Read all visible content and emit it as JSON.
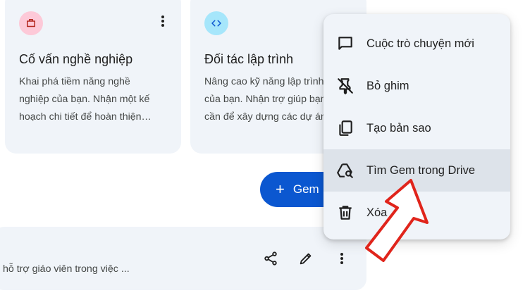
{
  "cards": [
    {
      "title": "Cố vấn nghề nghiệp",
      "desc_lines": [
        "Khai phá tiềm năng nghề",
        "nghiệp của bạn. Nhận một kế",
        "hoạch chi tiết để hoàn thiện…"
      ],
      "icon": "briefcase-icon",
      "icon_bg": "#fdc9d8",
      "icon_color": "#b3261e"
    },
    {
      "title": "Đối tác lập trình",
      "desc_lines": [
        "Nâng cao kỹ năng lập trình",
        "của bạn. Nhận trợ giúp bạn",
        "cần để xây dựng các dự án"
      ],
      "icon": "code-icon",
      "icon_bg": "#a6e6fb",
      "icon_color": "#0b57d0"
    }
  ],
  "new_gem_button": {
    "label": "Gem"
  },
  "bottom_card": {
    "desc": "hỗ trợ giáo viên trong việc ..."
  },
  "context_menu": {
    "items": [
      {
        "label": "Cuộc trò chuyện mới",
        "icon": "chat-bubble-icon"
      },
      {
        "label": "Bỏ ghim",
        "icon": "unpin-icon"
      },
      {
        "label": "Tạo bản sao",
        "icon": "copy-icon"
      },
      {
        "label": "Tìm Gem trong Drive",
        "icon": "drive-search-icon",
        "highlighted": true
      },
      {
        "label": "Xóa",
        "icon": "trash-icon"
      }
    ]
  },
  "colors": {
    "accent": "#0b57d0",
    "card_bg": "#f0f4f9",
    "hover_bg": "#dde3ea",
    "annotation_arrow": "#e0241b"
  }
}
